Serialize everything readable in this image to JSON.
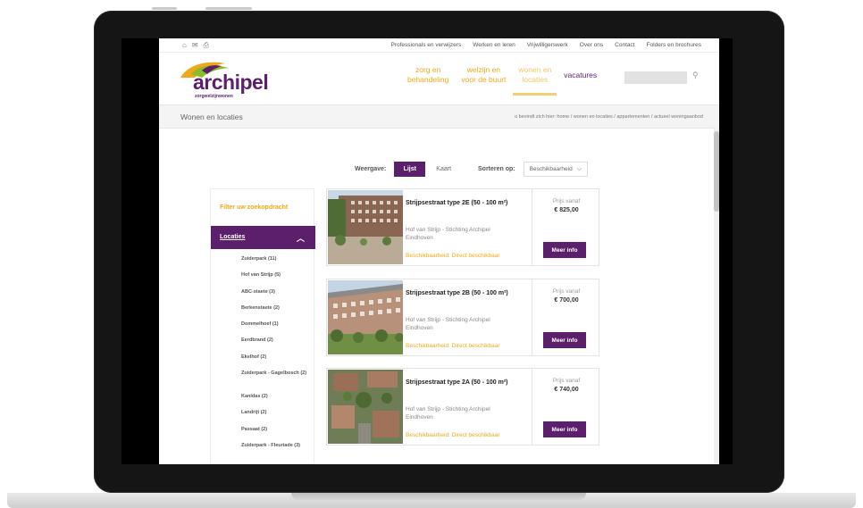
{
  "utility_bar": {
    "links": [
      "Professionals en verwijzers",
      "Werken en leren",
      "Vrijwilligerswerk",
      "Over ons",
      "Contact",
      "Folders en brochures"
    ]
  },
  "header": {
    "logo_word": "archipel",
    "logo_tag": "zorgwelzijnwonen",
    "nav": [
      {
        "line1": "zorg en",
        "line2": "behandeling"
      },
      {
        "line1": "welzijn en",
        "line2": "voor de buurt"
      },
      {
        "line1": "wonen en",
        "line2": "locaties"
      }
    ],
    "vacatures": "vacatures"
  },
  "breadcrumb": {
    "title": "Wonen en locaties",
    "path": "u bevindt zich hier: home / wonen en locaties / appartementen / actueel woningaanbod"
  },
  "view": {
    "label": "Weergave:",
    "list": "Lijst",
    "map": "Kaart",
    "sort_label": "Sorteren op:",
    "sort_value": "Beschikbaarheid"
  },
  "sidebar": {
    "filter_title": "Filter uw zoekopdracht",
    "locations_label": "Locaties",
    "locations": [
      "Zuiderpark (11)",
      "Hof van Strijp (5)",
      "ABC-staete (3)",
      "Berkenstaete (2)",
      "Dommelhoef (1)",
      "Eerdbrand (2)",
      "Ekelhof (2)",
      "Zuiderpark - Gagelbosch (2)",
      "Kanidas (2)",
      "Landrijt (2)",
      "Passaat (2)",
      "Zuiderpark - Fleuriade (3)"
    ]
  },
  "results": [
    {
      "title": "Strijpsestraat type 2E (50 - 100 m²)",
      "org_line1": "Hof van Strijp - Stichting Archipel",
      "org_line2": "Eindhoven",
      "availability": "Beschikbaarheid: Direct beschikbaar",
      "price_label": "Prijs vanaf",
      "price": "€ 825,00",
      "button": "Meer info"
    },
    {
      "title": "Strijpsestraat type 2B (50 - 100 m²)",
      "org_line1": "Hof van Strijp - Stichting Archipel",
      "org_line2": "Eindhoven",
      "availability": "Beschikbaarheid: Direct beschikbaar",
      "price_label": "Prijs vanaf",
      "price": "€ 700,00",
      "button": "Meer info"
    },
    {
      "title": "Strijpsestraat type 2A (50 - 100 m²)",
      "org_line1": "Hof van Strijp - Stichting Archipel",
      "org_line2": "Eindhoven",
      "availability": "Beschikbaarheid: Direct beschikbaar",
      "price_label": "Prijs vanaf",
      "price": "€ 740,00",
      "button": "Meer info"
    }
  ],
  "colors": {
    "brand_purple": "#5b1f6b",
    "accent_orange": "#f0a81b",
    "laptop_frame": "#151515"
  },
  "icons": [
    "home-icon",
    "mail-icon",
    "print-icon",
    "search-icon",
    "chevron-up-icon",
    "chevron-down-icon"
  ]
}
